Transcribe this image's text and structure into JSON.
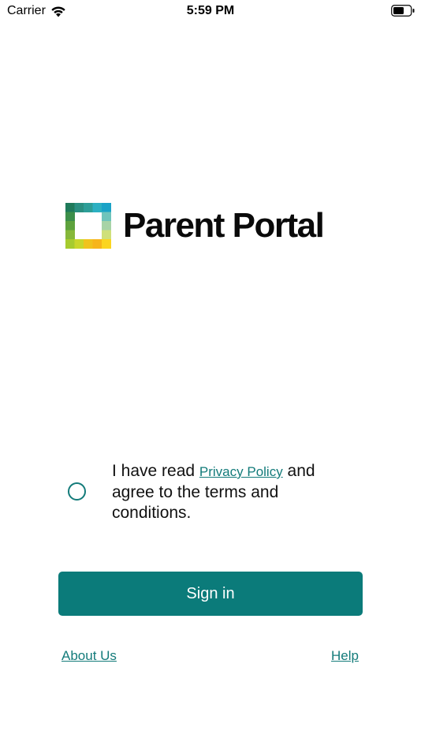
{
  "status_bar": {
    "carrier": "Carrier",
    "time": "5:59 PM",
    "icons": [
      "wifi-icon",
      "battery-icon"
    ]
  },
  "logo": {
    "text": "Parent Portal",
    "icon": "parent-portal-logo-icon"
  },
  "consent": {
    "text_before": "I have read ",
    "privacy_link": "Privacy Policy",
    "text_after": " and agree to the terms and conditions.",
    "checked": false
  },
  "signin": {
    "label": "Sign in"
  },
  "footer": {
    "about_label": "About Us",
    "help_label": "Help"
  },
  "colors": {
    "accent": "#0b7b7a",
    "text": "#111111",
    "background": "#ffffff"
  }
}
